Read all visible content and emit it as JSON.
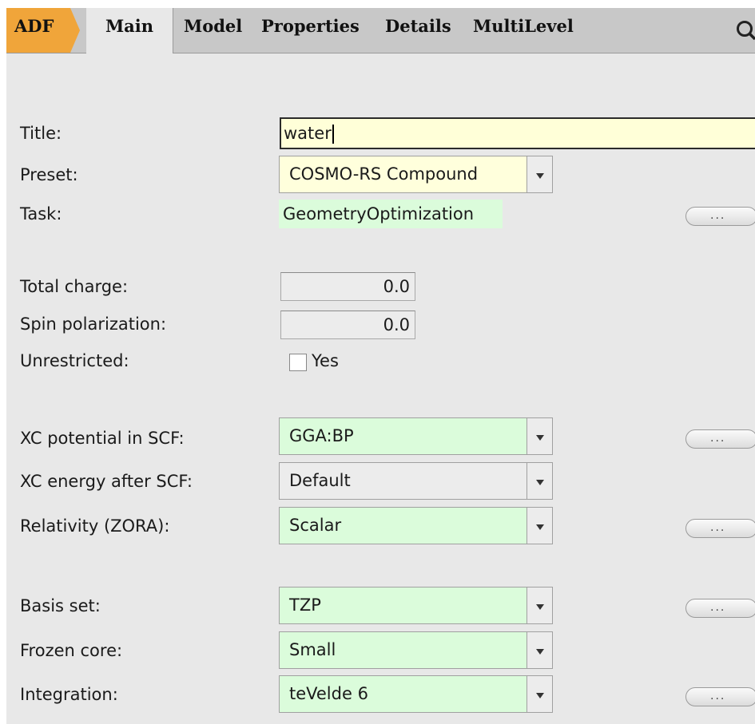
{
  "tabs": [
    "ADF",
    "Main",
    "Model",
    "Properties",
    "Details",
    "MultiLevel"
  ],
  "active_tab": "Main",
  "colors": {
    "adf_tab": "#f0a53a",
    "set_field_green": "#dbfcdb",
    "edited_field_yellow": "#ffffdc",
    "panel": "#e8e8e8"
  },
  "form": {
    "title": {
      "label": "Title:",
      "value": "water"
    },
    "preset": {
      "label": "Preset:",
      "value": "COSMO-RS Compound"
    },
    "task": {
      "label": "Task:",
      "value": "GeometryOptimization",
      "more": "..."
    },
    "total_charge": {
      "label": "Total charge:",
      "value": "0.0"
    },
    "spin_polarization": {
      "label": "Spin polarization:",
      "value": "0.0"
    },
    "unrestricted": {
      "label": "Unrestricted:",
      "checkbox_label": "Yes",
      "checked": false
    },
    "xc_scf": {
      "label": "XC potential in SCF:",
      "value": "GGA:BP",
      "more": "..."
    },
    "xc_after": {
      "label": "XC energy after SCF:",
      "value": "Default"
    },
    "relativity": {
      "label": "Relativity (ZORA):",
      "value": "Scalar",
      "more": "..."
    },
    "basis": {
      "label": "Basis set:",
      "value": "TZP",
      "more": "..."
    },
    "frozen_core": {
      "label": "Frozen core:",
      "value": "Small"
    },
    "integration": {
      "label": "Integration:",
      "value": "teVelde 6",
      "more": "..."
    }
  }
}
